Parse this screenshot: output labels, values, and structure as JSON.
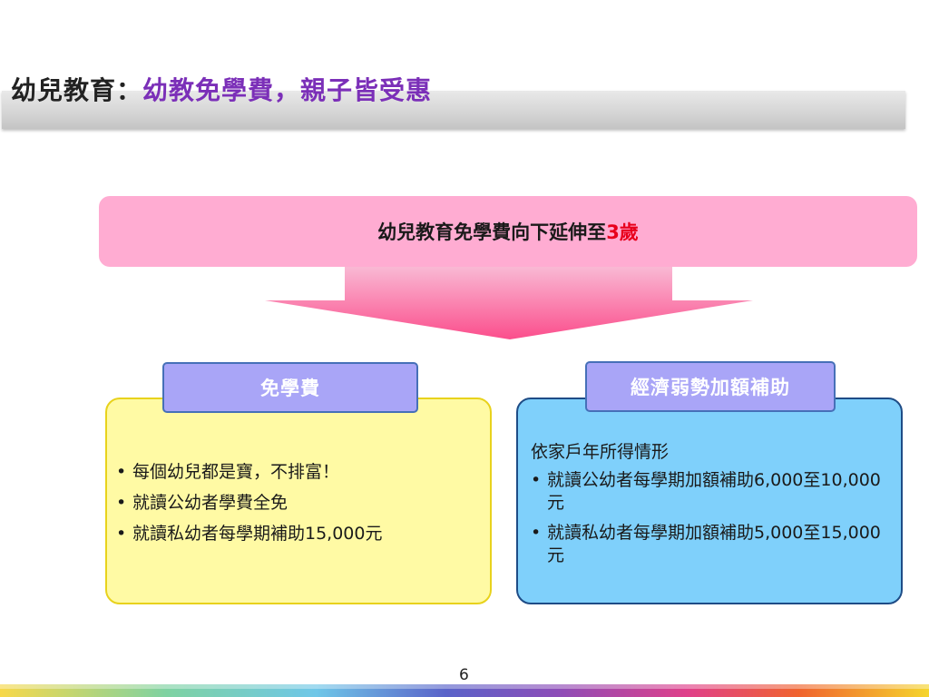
{
  "slide": {
    "title_prefix": "幼兒教育",
    "title_separator": "：",
    "title_highlight": "幼教免學費，親子皆受惠",
    "banner_text": "幼兒教育免學費向下延伸至",
    "banner_accent": "3歲",
    "left_tab": "免學費",
    "left_items": [
      "每個幼兒都是寶，不排富！",
      "就讀公幼者學費全免",
      "就讀私幼者每學期補助15,000元"
    ],
    "right_tab": "經濟弱勢加額補助",
    "right_intro": "依家戶年所得情形",
    "right_items": [
      "就讀公幼者每學期加額補助6,000至10,000元",
      "就讀私幼者每學期加額補助5,000至15,000元"
    ],
    "bullet": "•",
    "page_number": "6"
  },
  "colors": {
    "title_highlight": "#7b2fb8",
    "banner_bg": "#ffacd2",
    "banner_accent": "#e8001c",
    "tab_bg": "#a9a5f7",
    "left_box_bg": "#fffaa4",
    "right_box_bg": "#7fd0fb"
  }
}
